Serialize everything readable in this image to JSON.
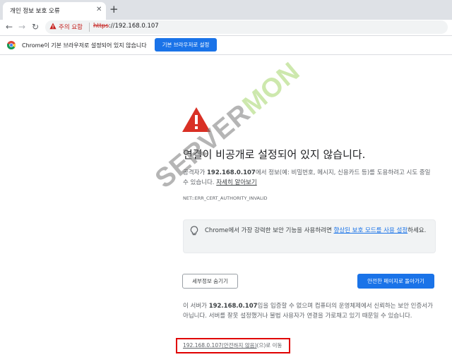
{
  "tab": {
    "title": "개인 정보 보호 오류",
    "close_glyph": "✕",
    "new_tab_glyph": "+"
  },
  "toolbar": {
    "back_glyph": "←",
    "forward_glyph": "→",
    "reload_glyph": "↻",
    "security_label": "주의 요함",
    "url_scheme": "https",
    "url_rest": "://192.168.0.107"
  },
  "infobar": {
    "message": "Chrome이 기본 브라우저로 설정되어 있지 않습니다",
    "button": "기본 브라우저로 설정"
  },
  "interstitial": {
    "heading": "연결이 비공개로 설정되어 있지 않습니다.",
    "body_pre": "공격자가 ",
    "body_host": "192.168.0.107",
    "body_mid": "에서 정보(예: 비밀번호, 메시지, 신용카드 등)를 도용하려고 시도 중일 수 있습니다. ",
    "learn_more": "자세히 알아보기",
    "error_code": "NET::ERR_CERT_AUTHORITY_INVALID",
    "promo_pre": "Chrome에서 가장 강력한 보안 기능을 사용하려면 ",
    "promo_link": "향상된 보호 모드를 사용 설정",
    "promo_post": "하세요.",
    "details_button": "세부정보 숨기기",
    "back_button": "안전한 페이지로 돌아가기",
    "detail_pre": "이 서버가 ",
    "detail_host": "192.168.0.107",
    "detail_post": "임을 입증할 수 없으며 컴퓨터의 운영체제에서 신뢰하는 보안 인증서가 아닙니다. 서버를 잘못 설정했거나 불법 사용자가 연결을 가로채고 있기 때문일 수 있습니다.",
    "proceed_link": "192.168.0.107(안전하지 않음)",
    "proceed_post": "(으)로 이동"
  },
  "watermark": {
    "part1": "SERVER",
    "part2": "MON"
  },
  "colors": {
    "accent": "#1a73e8",
    "danger": "#c5221f",
    "warning_icon": "#d93025",
    "highlight_box": "#e00000"
  },
  "icons": [
    "warning-icon",
    "chrome-icon",
    "lightbulb-icon"
  ]
}
